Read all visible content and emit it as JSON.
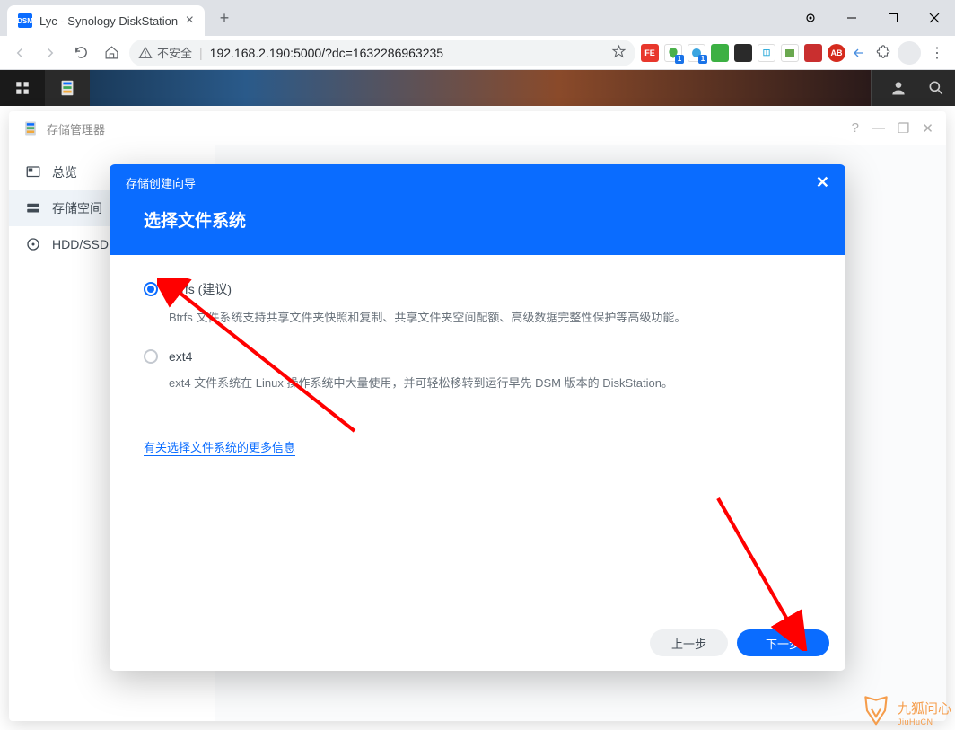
{
  "browser": {
    "tab_title": "Lyc - Synology DiskStation",
    "insecure_label": "不安全",
    "url": "192.168.2.190:5000/?dc=1632286963235",
    "ext_badge": "1"
  },
  "dsm_window": {
    "title": "存储管理器",
    "sidebar": {
      "overview": "总览",
      "storage": "存储空间",
      "hdd": "HDD/SSD"
    }
  },
  "modal": {
    "wizard_title": "存储创建向导",
    "heading": "选择文件系统",
    "opt1": {
      "label": "Btrfs (建议)",
      "desc": "Btrfs 文件系统支持共享文件夹快照和复制、共享文件夹空间配额、高级数据完整性保护等高级功能。"
    },
    "opt2": {
      "label": "ext4",
      "desc": "ext4 文件系统在 Linux 操作系统中大量使用，并可轻松移转到运行早先 DSM 版本的 DiskStation。"
    },
    "more_link": "有关选择文件系统的更多信息",
    "btn_prev": "上一步",
    "btn_next": "下一步"
  },
  "watermark": {
    "name": "九狐问心",
    "pinyin": "JiuHuCN"
  }
}
